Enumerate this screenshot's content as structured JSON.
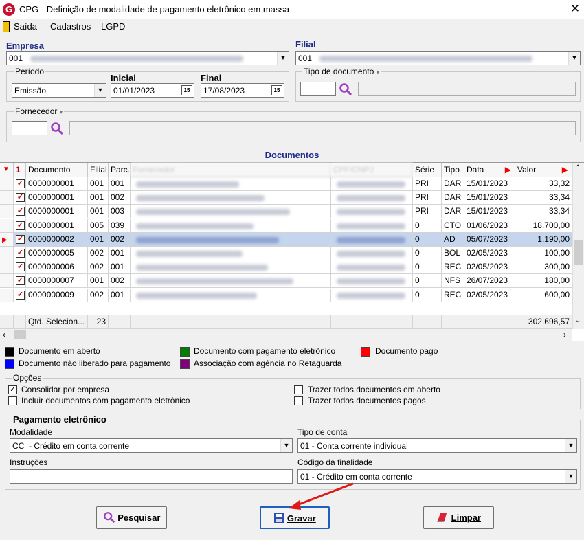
{
  "window": {
    "title": "CPG - Definição de modalidade de pagamento eletrônico em massa"
  },
  "menu": [
    "Saída",
    "Cadastros",
    "LGPD"
  ],
  "empresa": {
    "label": "Empresa",
    "code": "001"
  },
  "filial": {
    "label": "Filial",
    "code": "001"
  },
  "periodo": {
    "label": "Período",
    "value": "Emissão"
  },
  "inicial": {
    "label": "Inicial",
    "value": "01/01/2023"
  },
  "final": {
    "label": "Final",
    "value": "17/08/2023"
  },
  "tipo_documento": {
    "label": "Tipo de documento"
  },
  "fornecedor": {
    "label": "Fornecedor"
  },
  "documentos": {
    "title": "Documentos",
    "headers": [
      "Documento",
      "Filial",
      "Parc.",
      "Fornecedor",
      "CPF/CNPJ",
      "Série",
      "Tipo",
      "Data",
      "Valor"
    ],
    "rows": [
      {
        "documento": "0000000001",
        "filial": "001",
        "parc": "001",
        "serie": "PRI",
        "tipo": "DAR",
        "data": "15/01/2023",
        "valor": "33,32"
      },
      {
        "documento": "0000000001",
        "filial": "001",
        "parc": "002",
        "serie": "PRI",
        "tipo": "DAR",
        "data": "15/01/2023",
        "valor": "33,34"
      },
      {
        "documento": "0000000001",
        "filial": "001",
        "parc": "003",
        "serie": "PRI",
        "tipo": "DAR",
        "data": "15/01/2023",
        "valor": "33,34"
      },
      {
        "documento": "0000000001",
        "filial": "005",
        "parc": "039",
        "serie": "0",
        "tipo": "CTO",
        "data": "01/06/2023",
        "valor": "18.700,00"
      },
      {
        "documento": "0000000002",
        "filial": "001",
        "parc": "002",
        "serie": "0",
        "tipo": "AD",
        "data": "05/07/2023",
        "valor": "1.190,00"
      },
      {
        "documento": "0000000005",
        "filial": "002",
        "parc": "001",
        "serie": "0",
        "tipo": "BOL",
        "data": "02/05/2023",
        "valor": "100,00"
      },
      {
        "documento": "0000000006",
        "filial": "002",
        "parc": "001",
        "serie": "0",
        "tipo": "REC",
        "data": "02/05/2023",
        "valor": "300,00"
      },
      {
        "documento": "0000000007",
        "filial": "001",
        "parc": "002",
        "serie": "0",
        "tipo": "NFS",
        "data": "26/07/2023",
        "valor": "180,00"
      },
      {
        "documento": "0000000009",
        "filial": "002",
        "parc": "001",
        "serie": "0",
        "tipo": "REC",
        "data": "02/05/2023",
        "valor": "600,00"
      }
    ],
    "footer": {
      "label": "Qtd. Selecion...",
      "count": "23",
      "total": "302.696,57"
    }
  },
  "legend": [
    {
      "label": "Documento em aberto",
      "color": "#000000"
    },
    {
      "label": "Documento com pagamento eletrônico",
      "color": "#008000"
    },
    {
      "label": "Documento pago",
      "color": "#ff0000"
    },
    {
      "label": "Documento não liberado para pagamento",
      "color": "#0000ff"
    },
    {
      "label": "Associação com agência no Retaguarda",
      "color": "#800080"
    }
  ],
  "opcoes": {
    "label": "Opções",
    "items": [
      {
        "label": "Consolidar por empresa",
        "checked": true
      },
      {
        "label": "Incluir documentos com pagamento eletrônico",
        "checked": false
      },
      {
        "label": "Trazer todos documentos em aberto",
        "checked": false
      },
      {
        "label": "Trazer todos documentos pagos",
        "checked": false
      }
    ]
  },
  "pagamento": {
    "label": "Pagamento eletrônico",
    "modalidade_label": "Modalidade",
    "modalidade_value": "CC  - Crédito em conta corrente",
    "tipo_conta_label": "Tipo de conta",
    "tipo_conta_value": "01 - Conta corrente individual",
    "instrucoes_label": "Instruções",
    "finalidade_label": "Código da finalidade",
    "finalidade_value": "01 - Crédito em conta corrente"
  },
  "buttons": {
    "pesquisar": "Pesquisar",
    "gravar": "Gravar",
    "limpar": "Limpar"
  }
}
